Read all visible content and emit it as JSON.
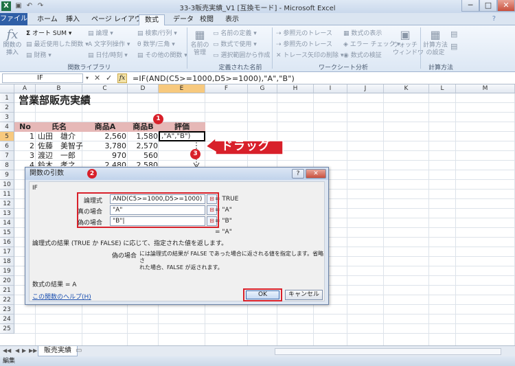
{
  "window": {
    "title": "33-3販売実績_V1 [互換モード] - Microsoft Excel",
    "controls": [
      "─",
      "□",
      "✕"
    ]
  },
  "tabs": [
    "ファイル",
    "ホーム",
    "挿入",
    "ページ レイアウト",
    "数式",
    "データ",
    "校閲",
    "表示"
  ],
  "ribbon": {
    "insert_function": "関数の\n挿入",
    "autosum": "オート SUM",
    "recent": "最近使用した関数",
    "financial": "財務",
    "logical": "論理",
    "text": "文字列操作",
    "datetime": "日付/時刻",
    "lookup": "検索/行列",
    "math": "数学/三角",
    "more": "その他の関数",
    "name_manager": "名前の\n管理",
    "define_name": "名前の定義",
    "use_in_formula": "数式で使用",
    "create_from_selection": "選択範囲から作成",
    "trace_precedents": "参照元のトレース",
    "trace_dependents": "参照先のトレース",
    "remove_arrows": "トレース矢印の削除",
    "show_formulas": "数式の表示",
    "error_checking": "エラー チェック",
    "evaluate_formula": "数式の検証",
    "watch_window": "ウォッチ\nウィンドウ",
    "calc_options": "計算方法\nの設定",
    "group_library": "関数ライブラリ",
    "group_names": "定義された名前",
    "group_audit": "ワークシート分析",
    "group_calc": "計算方法"
  },
  "formula_bar": {
    "name_box": "IF",
    "formula": "=IF(AND(C5>=1000,D5>=1000),\"A\",\"B\")"
  },
  "columns": [
    "A",
    "B",
    "C",
    "D",
    "E",
    "F",
    "G",
    "H",
    "I",
    "J",
    "K",
    "L",
    "M"
  ],
  "rows": [
    "1",
    "2",
    "3",
    "4",
    "5",
    "6",
    "7",
    "8",
    "9",
    "10",
    "11",
    "12",
    "13",
    "14",
    "15",
    "16",
    "17",
    "18",
    "19",
    "20",
    "21",
    "22",
    "23",
    "24",
    "25"
  ],
  "sheet": {
    "title": "営業部販売実績",
    "headers": [
      "No",
      "氏名",
      "商品A",
      "商品B",
      "評価"
    ],
    "data": [
      [
        "1",
        "山田　雄介",
        "2,560",
        "1,580"
      ],
      [
        "2",
        "佐藤　美智子",
        "3,780",
        "2,570"
      ],
      [
        "3",
        "渡辺　一郎",
        "970",
        "560"
      ],
      [
        "4",
        "鈴木　孝之",
        "2,480",
        "2,580"
      ]
    ],
    "active_cell_text": ",\"A\",\"B\")"
  },
  "dialog": {
    "title": "関数の引数",
    "help_btn": "?",
    "close_btn": "✕",
    "function_name": "IF",
    "args": [
      {
        "label": "論理式",
        "value": "AND(C5>=1000,D5>=1000)",
        "result": "TRUE"
      },
      {
        "label": "真の場合",
        "value": "\"A\"",
        "result": "\"A\""
      },
      {
        "label": "偽の場合",
        "value": "\"B\"|",
        "result": "\"B\""
      }
    ],
    "overall_result": "\"A\"",
    "description": "論理式の結果 (TRUE か FALSE) に応じて、指定された値を返します。",
    "param_name": "偽の場合",
    "param_desc_1": "には論理式の結果が FALSE であった場合に返される値を指定します。省略さ",
    "param_desc_2": "れた場合、FALSE が返されます。",
    "formula_result_label": "数式の結果 =",
    "formula_result": "A",
    "help_link": "この関数のヘルプ(H)",
    "ok": "OK",
    "cancel": "キャンセル"
  },
  "annotations": {
    "badge1": "1",
    "badge2": "2",
    "badge3": "3",
    "drag": "ドラッグ"
  },
  "sheet_tab": "販売実績",
  "status": "編集",
  "colors": {
    "header_fill": "#e6b8b7",
    "accent_red": "#d8202a",
    "file_tab": "#2f5fa7"
  }
}
